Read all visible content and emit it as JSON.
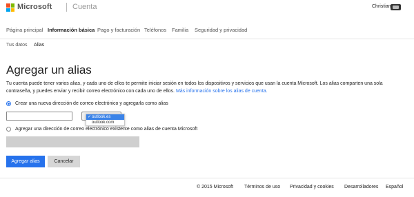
{
  "header": {
    "brand": "Microsoft",
    "product": "Cuenta",
    "user_name": "Christian",
    "logo_colors": [
      "#f25022",
      "#7fba00",
      "#00a4ef",
      "#ffb900"
    ]
  },
  "nav": {
    "items": [
      {
        "label": "Página principal"
      },
      {
        "label": "Información básica"
      },
      {
        "label": "Pago y facturación"
      },
      {
        "label": "Teléfonos"
      },
      {
        "label": "Familia"
      },
      {
        "label": "Seguridad y privacidad"
      }
    ],
    "active": "Información básica"
  },
  "subnav": {
    "items": [
      {
        "label": "Tus datos"
      },
      {
        "label": "Alias"
      }
    ],
    "active": "Alias"
  },
  "page": {
    "title": "Agregar un alias",
    "description": "Tu cuenta puede tener varios alias, y cada uno de ellos te permite iniciar sesión en todos los dispositivos y servicios que usan la cuenta Microsoft. Los alias comparten una sola contraseña, y puedes enviar y recibir correo electrónico con cada uno de ellos.",
    "more_info_link": "Más información sobre los alias de cuenta."
  },
  "options": {
    "create_new": {
      "label": "Crear una nueva dirección de correo electrónico y agregarla como alias",
      "selected": true
    },
    "alias_input": {
      "value": ""
    },
    "domain_select": {
      "options": [
        "outlook.es",
        "outlook.com"
      ],
      "selected": "outlook.es",
      "check": "✓"
    },
    "existing": {
      "label": "Agregar una dirección de correo electrónico existente como alias de cuenta Microsoft",
      "selected": false
    }
  },
  "buttons": {
    "add": "Agregar alias",
    "cancel": "Cancelar"
  },
  "footer": {
    "copyright": "© 2015 Microsoft",
    "terms": "Términos de uso",
    "privacy": "Privacidad y cookies",
    "developers": "Desarrolladores",
    "language": "Español"
  },
  "colors": {
    "accent": "#2672ec",
    "select_highlight": "#3b83e8"
  }
}
